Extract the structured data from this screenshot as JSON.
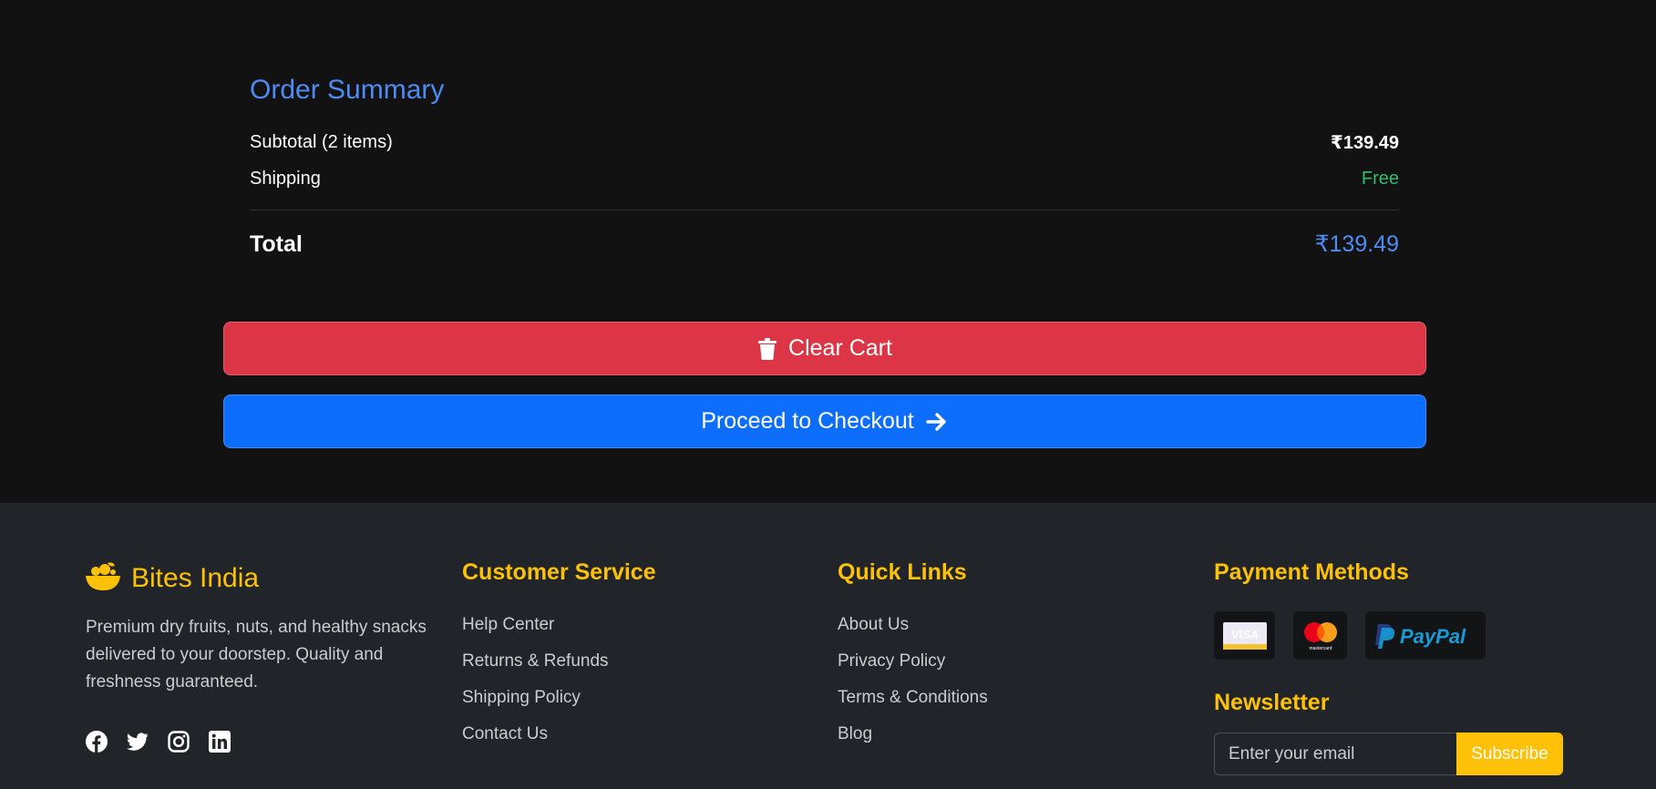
{
  "summary": {
    "title": "Order Summary",
    "subtotal_label": "Subtotal (2 items)",
    "subtotal_value": "₹139.49",
    "shipping_label": "Shipping",
    "shipping_value": "Free",
    "total_label": "Total",
    "total_value": "₹139.49"
  },
  "actions": {
    "clear_label": "Clear Cart",
    "checkout_label": "Proceed to Checkout"
  },
  "footer": {
    "brand": {
      "name": "Bites India",
      "description": "Premium dry fruits, nuts, and healthy snacks delivered to your doorstep. Quality and freshness guaranteed.",
      "socials": [
        "facebook-icon",
        "twitter-icon",
        "instagram-icon",
        "linkedin-icon"
      ]
    },
    "customer_service": {
      "title": "Customer Service",
      "links": [
        "Help Center",
        "Returns & Refunds",
        "Shipping Policy",
        "Contact Us"
      ]
    },
    "quick_links": {
      "title": "Quick Links",
      "links": [
        "About Us",
        "Privacy Policy",
        "Terms & Conditions",
        "Blog"
      ]
    },
    "payment": {
      "title": "Payment Methods",
      "methods": [
        "VISA",
        "mastercard",
        "PayPal"
      ]
    },
    "newsletter": {
      "title": "Newsletter",
      "placeholder": "Enter your email",
      "button_label": "Subscribe"
    }
  },
  "colors": {
    "accent": "#ffc107",
    "primary": "#0d6efd",
    "danger": "#dc3545",
    "success": "#2ebd6b",
    "link_blue": "#4d8cf5"
  }
}
